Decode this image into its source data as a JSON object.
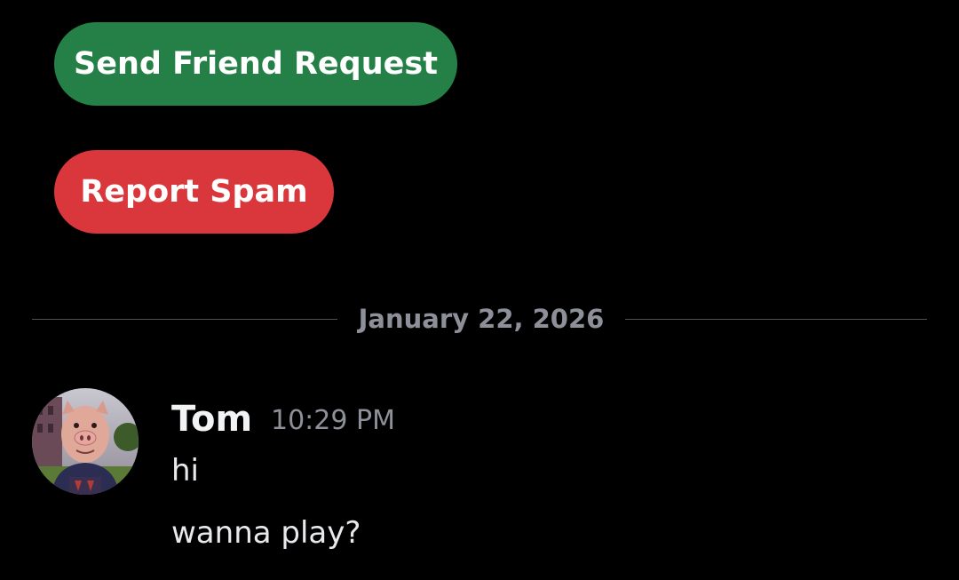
{
  "actions": {
    "send_friend_request": "Send Friend Request",
    "report_spam": "Report Spam"
  },
  "date_divider": "January 22, 2026",
  "message": {
    "author": "Tom",
    "timestamp": "10:29 PM",
    "lines": [
      "hi",
      "wanna play?"
    ]
  },
  "colors": {
    "background": "#000000",
    "friend_button": "#248046",
    "spam_button": "#da373c",
    "muted_text": "#8e9099",
    "divider": "#4e5058"
  }
}
